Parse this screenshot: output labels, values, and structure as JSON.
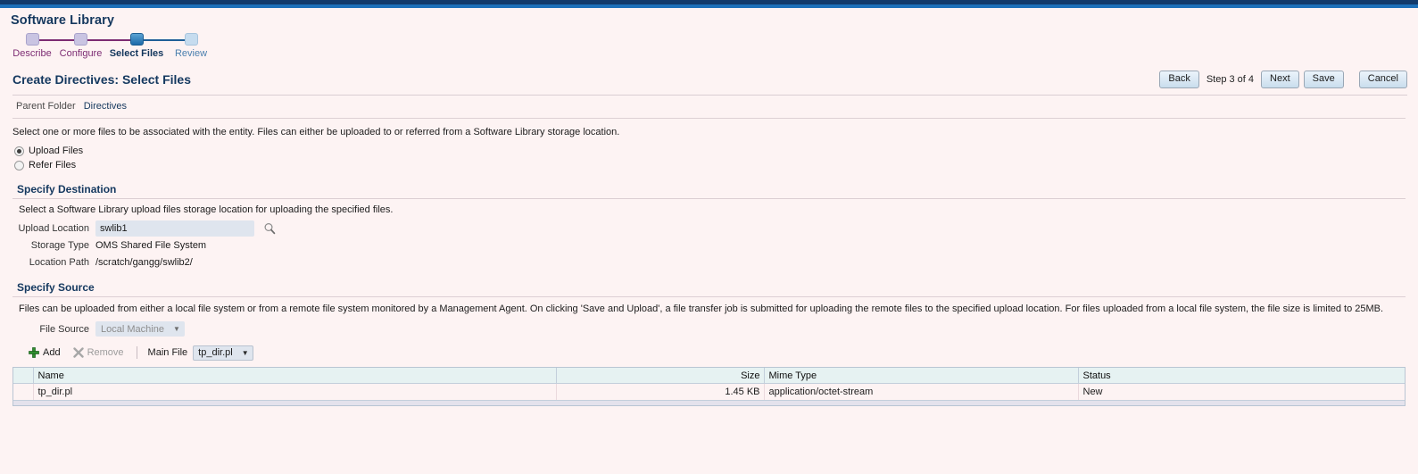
{
  "app": {
    "title": "Software Library"
  },
  "train": {
    "steps": [
      {
        "label": "Describe",
        "state": "visited"
      },
      {
        "label": "Configure",
        "state": "visited"
      },
      {
        "label": "Select Files",
        "state": "current"
      },
      {
        "label": "Review",
        "state": "future"
      }
    ]
  },
  "header": {
    "page_title": "Create Directives: Select Files",
    "step_text": "Step 3 of 4",
    "buttons": {
      "back": "Back",
      "next": "Next",
      "save": "Save",
      "cancel": "Cancel"
    }
  },
  "parent_folder": {
    "label": "Parent Folder",
    "value": "Directives"
  },
  "instruction": "Select one or more files to be associated with the entity. Files can either be uploaded to or referred from a Software Library storage location.",
  "file_mode": {
    "options": [
      {
        "label": "Upload Files",
        "selected": true
      },
      {
        "label": "Refer Files",
        "selected": false
      }
    ]
  },
  "destination": {
    "title": "Specify Destination",
    "subtitle": "Select a Software Library upload files storage location for uploading the specified files.",
    "upload_location": {
      "label": "Upload Location",
      "value": "swlib1",
      "search_icon": "search-icon"
    },
    "storage_type": {
      "label": "Storage Type",
      "value": "OMS Shared File System"
    },
    "location_path": {
      "label": "Location Path",
      "value": "/scratch/gangg/swlib2/"
    }
  },
  "source": {
    "title": "Specify Source",
    "note": "Files can be uploaded from either a local file system or from a remote file system monitored by a Management Agent. On clicking 'Save and Upload', a file transfer job is submitted for uploading the remote files to the specified upload location. For files uploaded from a local file system, the file size is limited to 25MB.",
    "file_source": {
      "label": "File Source",
      "value": "Local Machine",
      "disabled": true
    },
    "toolbar": {
      "add": "Add",
      "add_icon": "plus-icon",
      "remove": "Remove",
      "remove_icon": "remove-x-icon",
      "main_file_label": "Main File",
      "main_file_value": "tp_dir.pl"
    },
    "table": {
      "columns": [
        "Name",
        "Size",
        "Mime Type",
        "Status"
      ],
      "rows": [
        {
          "name": "tp_dir.pl",
          "size": "1.45 KB",
          "mime": "application/octet-stream",
          "status": "New"
        }
      ]
    }
  },
  "colors": {
    "topbar_dark": "#123a6b",
    "topbar_blue": "#1d6fb8",
    "background": "#fdf3f3",
    "heading": "#14385f",
    "visited_step": "#7c2b72",
    "current_step": "#2878b6",
    "table_header": "#e6f2f2"
  }
}
